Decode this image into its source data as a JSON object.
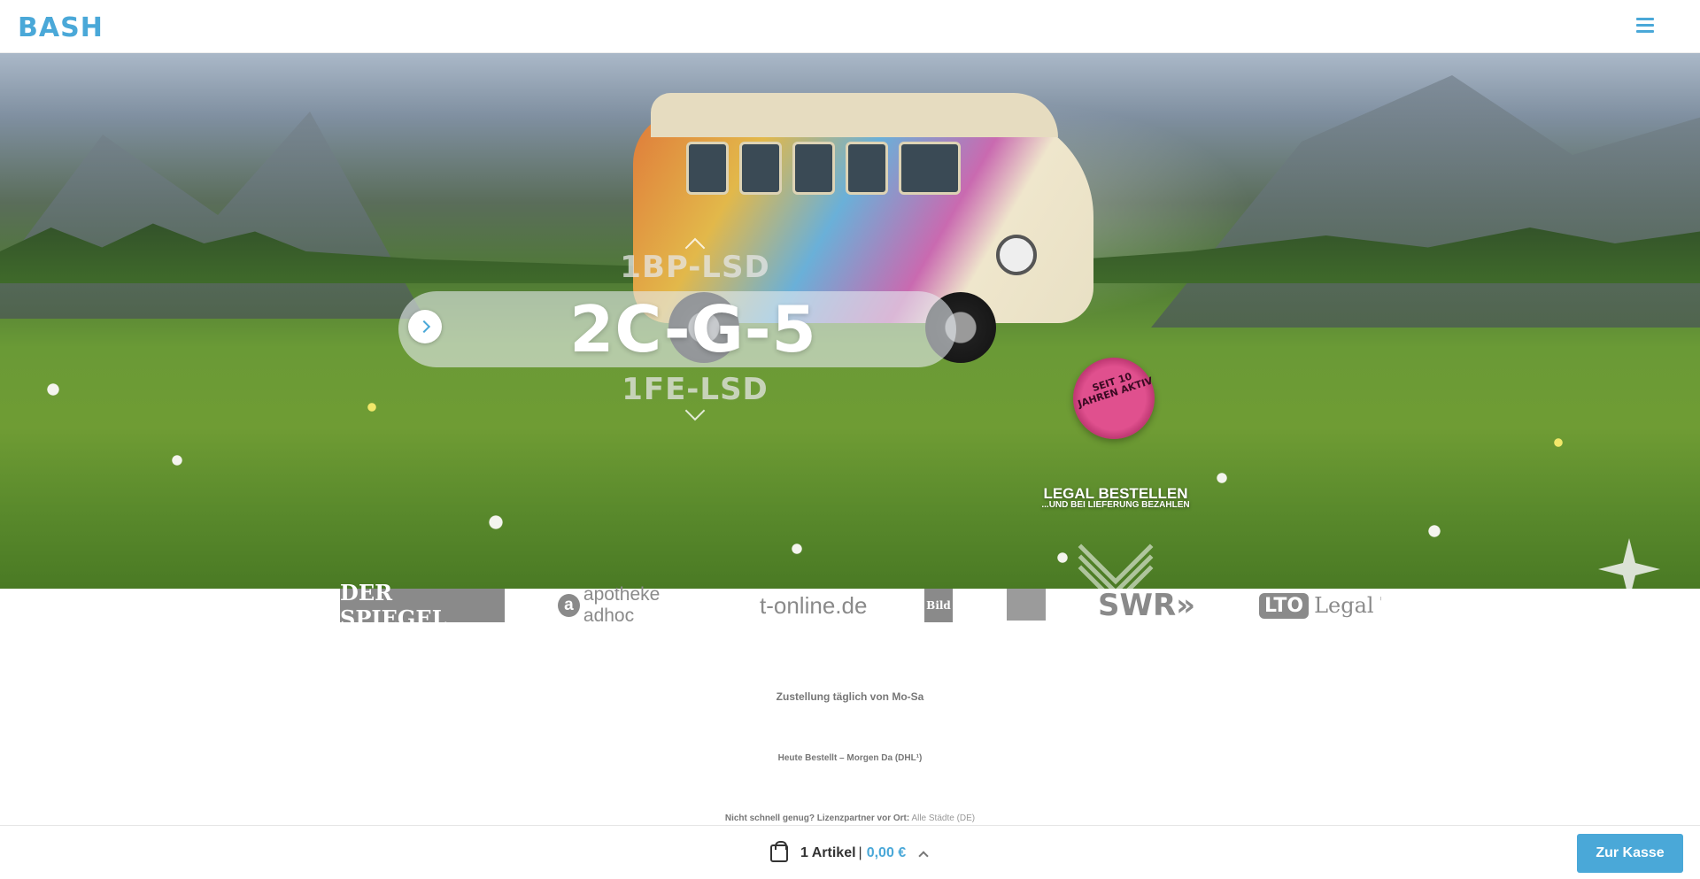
{
  "header": {
    "logo_text": "BASH",
    "menu_icon": "hamburger-menu-icon"
  },
  "hero": {
    "carousel": {
      "previous_item": "1BP-LSD",
      "current_item": "2C-G-5",
      "next_item": "1FE-LSD"
    },
    "seal_text": "SEIT 10 JAHREN AKTIV",
    "legal_title": "LEGAL BESTELLEN",
    "legal_subtitle": "...UND BEI LIEFERUNG BEZAHLEN"
  },
  "press_logos": {
    "spiegel": "DER SPIEGEL",
    "apotheke_badge": "a",
    "apotheke": "apotheke adhoc",
    "tonline": "t-online.de",
    "bild": "Bild",
    "swr": "SWR»",
    "lto_badge": "LTO",
    "lto": "Legal T"
  },
  "info": {
    "delivery_days": "Zustellung täglich von Mo-Sa",
    "order_promise": "Heute Bestellt – Morgen Da (DHL¹)",
    "partner_label": "Nicht schnell genug? Lizenzpartner vor Ort:",
    "partner_link": "Alle Städte (DE)"
  },
  "cart": {
    "item_count": "1 Artikel",
    "separator": "|",
    "total": "0,00 €",
    "checkout_label": "Zur Kasse"
  },
  "colors": {
    "accent": "#4aa8d8",
    "seal": "#e0508e"
  }
}
